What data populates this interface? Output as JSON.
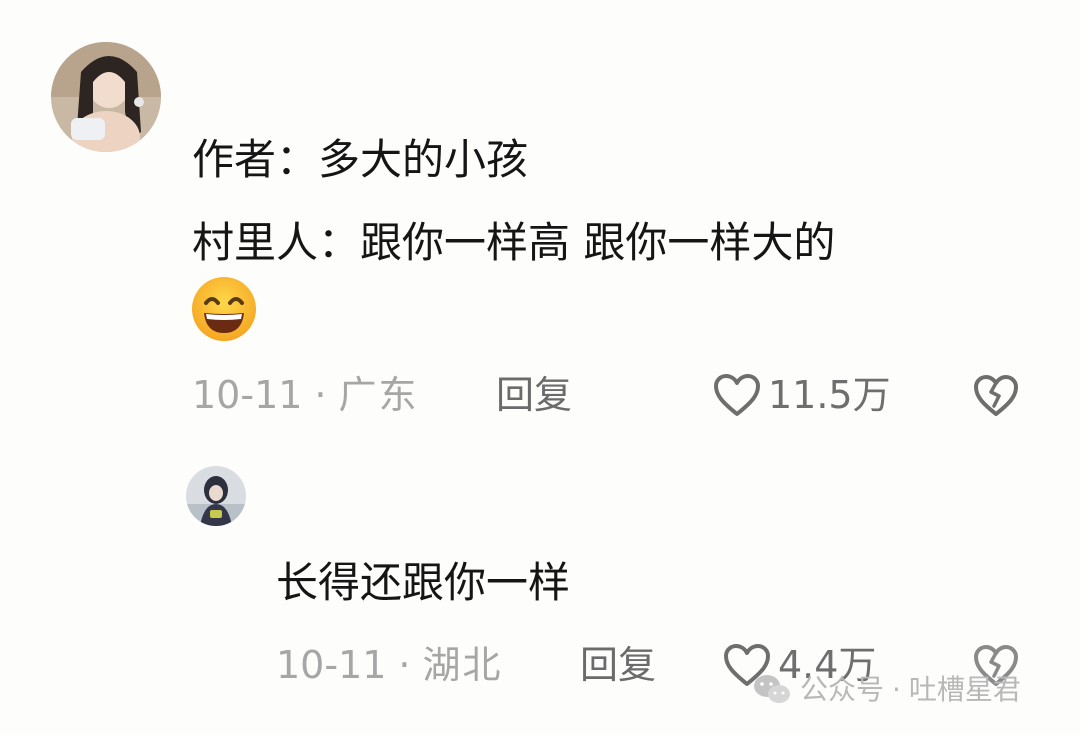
{
  "comment": {
    "line1": "作者：多大的小孩",
    "line2": "村里人：跟你一样高 跟你一样大的",
    "emoji": "grinning-face-emoji",
    "date": "10-11",
    "separator": "·",
    "region": "广东",
    "reply_label": "回复",
    "likes": "11.5万"
  },
  "reply": {
    "text": "长得还跟你一样",
    "date": "10-11",
    "separator": "·",
    "region": "湖北",
    "reply_label": "回复",
    "likes": "4.4万"
  },
  "watermark": {
    "platform": "公众号",
    "separator": "·",
    "account": "吐槽星君"
  },
  "icons": {
    "like": "heart-outline-icon",
    "dislike": "broken-heart-icon",
    "wechat": "wechat-icon"
  },
  "colors": {
    "background": "#fdfdfb",
    "text": "#151515",
    "meta": "#a6a6a6",
    "action": "#6e6e6e"
  }
}
